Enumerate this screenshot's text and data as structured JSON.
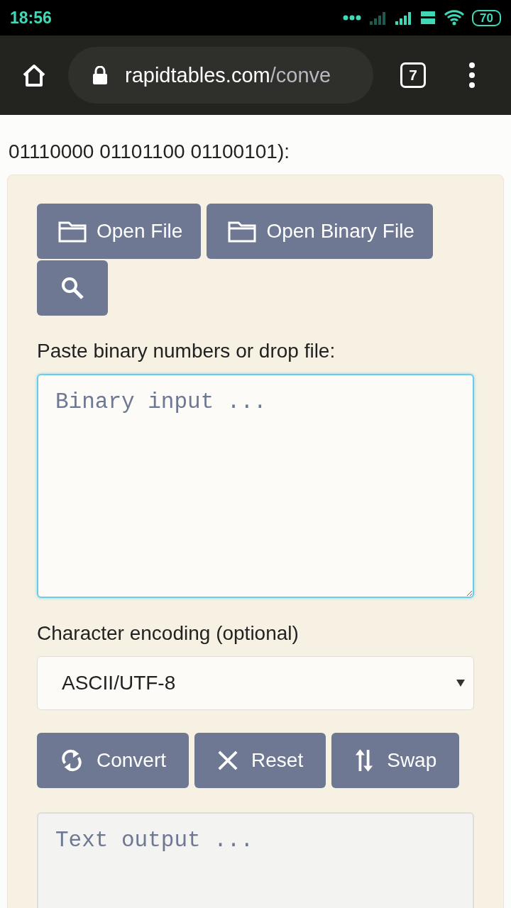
{
  "status_bar": {
    "time": "18:56",
    "battery": "70"
  },
  "browser": {
    "url_host": "rapidtables.com",
    "url_path": "/conve",
    "tab_count": "7"
  },
  "intro_text": "01110000 01101100 01100101):",
  "file_buttons": [
    {
      "label": "Open File"
    },
    {
      "label": "Open Binary File"
    },
    {
      "kind": "search"
    }
  ],
  "input_label": "Paste binary numbers or drop file:",
  "input": {
    "placeholder": "Binary input ...",
    "focused": true
  },
  "encoding": {
    "label": "Character encoding (optional)",
    "value": "ASCII/UTF-8"
  },
  "action_buttons": [
    {
      "label": "Convert"
    },
    {
      "label": "Reset"
    },
    {
      "label": "Swap"
    }
  ],
  "output": {
    "placeholder": "Text output ..."
  }
}
